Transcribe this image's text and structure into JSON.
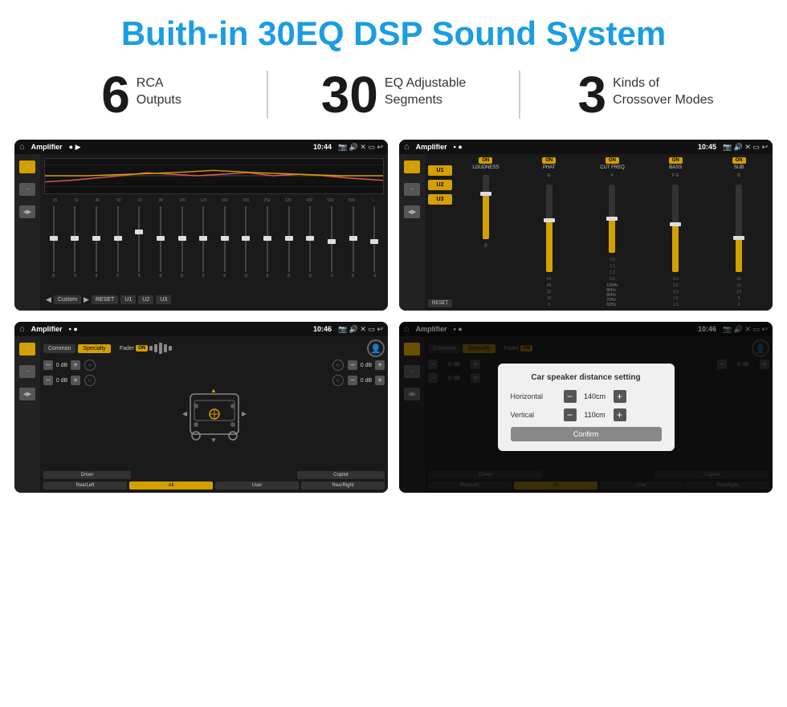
{
  "header": {
    "title": "Buith-in 30EQ DSP Sound System"
  },
  "stats": [
    {
      "number": "6",
      "label": "RCA\nOutputs"
    },
    {
      "number": "30",
      "label": "EQ Adjustable\nSegments"
    },
    {
      "number": "3",
      "label": "Kinds of\nCrossover Modes"
    }
  ],
  "screens": [
    {
      "id": "screen1",
      "statusBar": {
        "title": "Amplifier",
        "time": "10:44"
      },
      "type": "eq"
    },
    {
      "id": "screen2",
      "statusBar": {
        "title": "Amplifier",
        "time": "10:45"
      },
      "type": "amp"
    },
    {
      "id": "screen3",
      "statusBar": {
        "title": "Amplifier",
        "time": "10:46"
      },
      "type": "fader"
    },
    {
      "id": "screen4",
      "statusBar": {
        "title": "Amplifier",
        "time": "10:46"
      },
      "type": "fader-dialog",
      "dialog": {
        "title": "Car speaker distance setting",
        "horizontal_label": "Horizontal",
        "horizontal_value": "140cm",
        "vertical_label": "Vertical",
        "vertical_value": "110cm",
        "confirm_label": "Confirm"
      }
    }
  ],
  "eq": {
    "frequencies": [
      "25",
      "32",
      "40",
      "50",
      "63",
      "80",
      "100",
      "125",
      "160",
      "200",
      "250",
      "320",
      "400",
      "500",
      "630"
    ],
    "values": [
      "0",
      "0",
      "0",
      "0",
      "5",
      "0",
      "0",
      "0",
      "0",
      "0",
      "0",
      "0",
      "0",
      "-1",
      "0",
      "-1"
    ],
    "preset_label": "Custom",
    "buttons": [
      "RESET",
      "U1",
      "U2",
      "U3"
    ]
  },
  "amp": {
    "presets": [
      "U1",
      "U2",
      "U3"
    ],
    "controls": [
      "LOUDNESS",
      "PHAT",
      "CUT FREQ",
      "BASS",
      "SUB"
    ]
  },
  "fader": {
    "tabs": [
      "Common",
      "Specialty"
    ],
    "fader_label": "Fader",
    "db_values": [
      "0 dB",
      "0 dB",
      "0 dB",
      "0 dB"
    ],
    "bottom_btns": [
      "Driver",
      "",
      "",
      "Copilot",
      "RearLeft",
      "All",
      "User",
      "RearRight"
    ]
  }
}
